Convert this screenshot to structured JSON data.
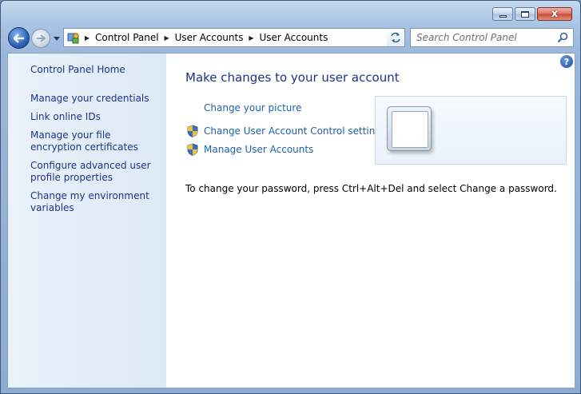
{
  "window": {
    "minimize_glyph": "minimize-glyph",
    "maximize_glyph": "maximize-glyph",
    "close_glyph": "x"
  },
  "address_bar": {
    "icon": "control-panel-icon",
    "breadcrumbs": [
      "Control Panel",
      "User Accounts",
      "User Accounts"
    ]
  },
  "search": {
    "placeholder": "Search Control Panel"
  },
  "sidebar": {
    "home_link": "Control Panel Home",
    "items": [
      "Manage your credentials",
      "Link online IDs",
      "Manage your file encryption certificates",
      "Configure advanced user profile properties",
      "Change my environment variables"
    ]
  },
  "main": {
    "heading": "Make changes to your user account",
    "tasks": [
      {
        "label": "Change your picture",
        "icon": ""
      },
      {
        "label": "Change User Account Control settings",
        "icon": "uac-shield-icon"
      },
      {
        "label": "Manage User Accounts",
        "icon": "uac-shield-icon"
      }
    ],
    "password_note": "To change your password, press Ctrl+Alt+Del and select Change a password.",
    "help_glyph": "?"
  },
  "colors": {
    "link": "#1e5fa8",
    "heading": "#1e3287",
    "sidebar_bg": "#dde9f6",
    "frame": "#9ab6da"
  }
}
